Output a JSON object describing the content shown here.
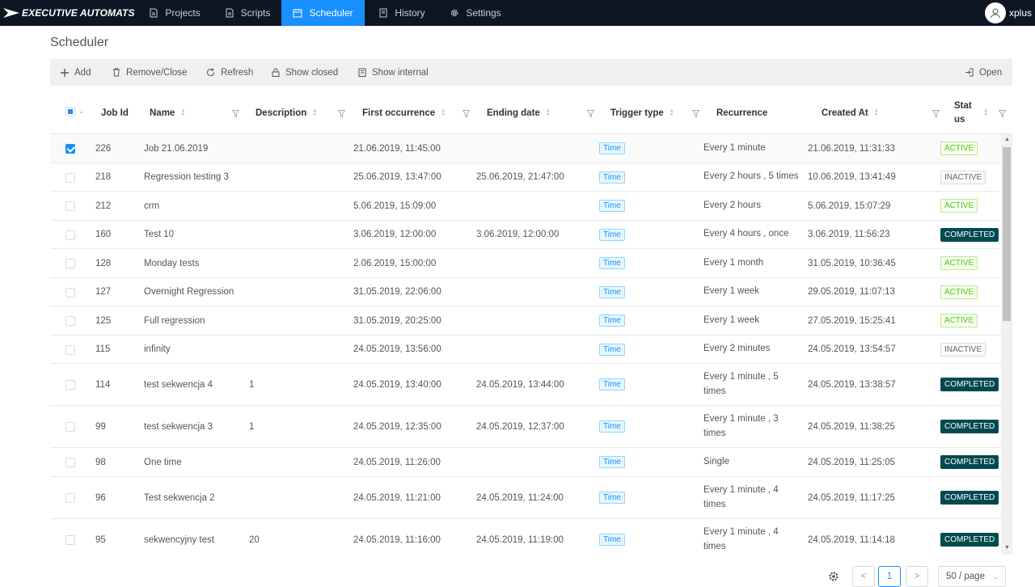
{
  "app": {
    "brand": "EXECUTIVE AUTOMATS",
    "user": "xplus"
  },
  "nav": [
    {
      "label": "Projects",
      "icon": "file-icon"
    },
    {
      "label": "Scripts",
      "icon": "file-icon"
    },
    {
      "label": "Scheduler",
      "icon": "calendar-icon",
      "active": true
    },
    {
      "label": "History",
      "icon": "book-icon"
    },
    {
      "label": "Settings",
      "icon": "gear-icon"
    }
  ],
  "page": {
    "title": "Scheduler"
  },
  "toolbar": {
    "add": "Add",
    "remove": "Remove/Close",
    "refresh": "Refresh",
    "show_closed": "Show closed",
    "show_internal": "Show internal",
    "open": "Open"
  },
  "columns": {
    "job_id": "Job Id",
    "name": "Name",
    "description": "Description",
    "first": "First occurrence",
    "ending": "Ending date",
    "trigger": "Trigger type",
    "recurrence": "Recurrence",
    "created": "Created At",
    "status": "Status"
  },
  "rows": [
    {
      "id": "226",
      "name": "Job 21.06.2019",
      "desc": "",
      "first": "21.06.2019, 11:45:00",
      "ending": "",
      "trigger": "Time",
      "recurrence": "Every 1 minute",
      "created": "21.06.2019, 11:31:33",
      "status": "ACTIVE",
      "checked": true
    },
    {
      "id": "218",
      "name": "Regression testing 3",
      "desc": "",
      "first": "25.06.2019, 13:47:00",
      "ending": "25.06.2019, 21:47:00",
      "trigger": "Time",
      "recurrence": "Every 2 hours , 5 times",
      "created": "10.06.2019, 13:41:49",
      "status": "INACTIVE"
    },
    {
      "id": "212",
      "name": "crm",
      "desc": "",
      "first": "5.06.2019, 15:09:00",
      "ending": "",
      "trigger": "Time",
      "recurrence": "Every 2 hours",
      "created": "5.06.2019, 15:07:29",
      "status": "ACTIVE"
    },
    {
      "id": "160",
      "name": "Test 10",
      "desc": "",
      "first": "3.06.2019, 12:00:00",
      "ending": "3.06.2019, 12:00:00",
      "trigger": "Time",
      "recurrence": "Every 4 hours , once",
      "created": "3.06.2019, 11:56:23",
      "status": "COMPLETED"
    },
    {
      "id": "128",
      "name": "Monday tests",
      "desc": "",
      "first": "2.06.2019, 15:00:00",
      "ending": "",
      "trigger": "Time",
      "recurrence": "Every 1 month",
      "created": "31.05.2019, 10:36:45",
      "status": "ACTIVE"
    },
    {
      "id": "127",
      "name": "Overnight Regression",
      "desc": "",
      "first": "31.05.2019, 22:06:00",
      "ending": "",
      "trigger": "Time",
      "recurrence": "Every 1 week",
      "created": "29.05.2019, 11:07:13",
      "status": "ACTIVE"
    },
    {
      "id": "125",
      "name": "Full regression",
      "desc": "",
      "first": "31.05.2019, 20:25:00",
      "ending": "",
      "trigger": "Time",
      "recurrence": "Every 1 week",
      "created": "27.05.2019, 15:25:41",
      "status": "ACTIVE"
    },
    {
      "id": "115",
      "name": "infinity",
      "desc": "",
      "first": "24.05.2019, 13:56:00",
      "ending": "",
      "trigger": "Time",
      "recurrence": "Every 2 minutes",
      "created": "24.05.2019, 13:54:57",
      "status": "INACTIVE"
    },
    {
      "id": "114",
      "name": "test sekwencja 4",
      "desc": "1",
      "first": "24.05.2019, 13:40:00",
      "ending": "24.05.2019, 13:44:00",
      "trigger": "Time",
      "recurrence": "Every 1 minute , 5 times",
      "created": "24.05.2019, 13:38:57",
      "status": "COMPLETED"
    },
    {
      "id": "99",
      "name": "test sekwencja 3",
      "desc": "1",
      "first": "24.05.2019, 12:35:00",
      "ending": "24.05.2019, 12:37:00",
      "trigger": "Time",
      "recurrence": "Every 1 minute , 3 times",
      "created": "24.05.2019, 11:38:25",
      "status": "COMPLETED"
    },
    {
      "id": "98",
      "name": "One time",
      "desc": "",
      "first": "24.05.2019, 11:26:00",
      "ending": "",
      "trigger": "Time",
      "recurrence": "Single",
      "created": "24.05.2019, 11:25:05",
      "status": "COMPLETED"
    },
    {
      "id": "96",
      "name": "Test sekwencja 2",
      "desc": "",
      "first": "24.05.2019, 11:21:00",
      "ending": "24.05.2019, 11:24:00",
      "trigger": "Time",
      "recurrence": "Every 1 minute , 4 times",
      "created": "24.05.2019, 11:17:25",
      "status": "COMPLETED"
    },
    {
      "id": "95",
      "name": "sekwencyjny test",
      "desc": "20",
      "first": "24.05.2019, 11:16:00",
      "ending": "24.05.2019, 11:19:00",
      "trigger": "Time",
      "recurrence": "Every 1 minute , 4 times",
      "created": "24.05.2019, 11:14:18",
      "status": "COMPLETED"
    }
  ],
  "pagination": {
    "current": "1",
    "prev": "<",
    "next": ">",
    "page_size": "50 / page"
  },
  "colors": {
    "nav_bg": "#0e1624",
    "accent": "#1890ff",
    "completed": "#004a4f"
  }
}
